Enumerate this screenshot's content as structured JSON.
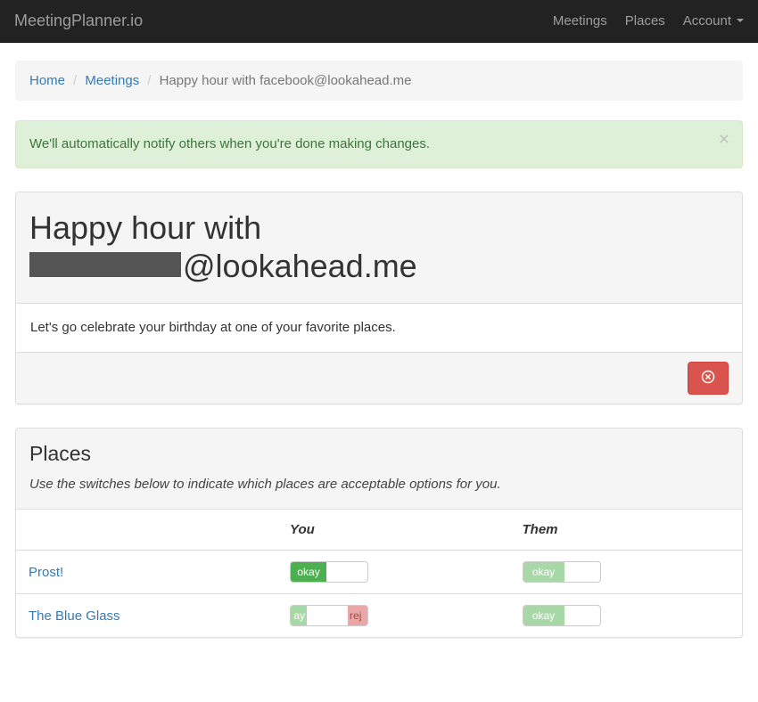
{
  "navbar": {
    "brand": "MeetingPlanner.io",
    "links": [
      "Meetings",
      "Places",
      "Account"
    ]
  },
  "breadcrumb": {
    "items": [
      {
        "label": "Home",
        "active": false
      },
      {
        "label": "Meetings",
        "active": false
      },
      {
        "label": "Happy hour with facebook@lookahead.me",
        "active": true
      }
    ]
  },
  "alert": {
    "message": "We'll automatically notify others when you're done making changes."
  },
  "meeting": {
    "title_prefix": "Happy hour with",
    "title_suffix": "@lookahead.me",
    "description": "Let's go celebrate your birthday at one of your favorite places."
  },
  "places_panel": {
    "title": "Places",
    "hint": "Use the switches below to indicate which places are acceptable options for you.",
    "col_you": "You",
    "col_them": "Them",
    "rows": [
      {
        "name": "Prost!",
        "you_label": "okay",
        "you_state": "on",
        "them_label": "okay",
        "them_state": "muted"
      },
      {
        "name": "The Blue Glass",
        "you_left": "ay",
        "you_right": "rej",
        "you_state": "split",
        "them_label": "okay",
        "them_state": "muted"
      }
    ]
  }
}
